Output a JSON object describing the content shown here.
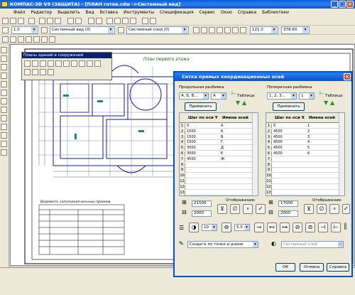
{
  "window": {
    "title": "КОМПАС-3D V9 (ЗАЩИТА) - [ПЛАН готов.cdw ->Системный вид]"
  },
  "menu": [
    "Файл",
    "Редактор",
    "Выделить",
    "Вид",
    "Вставка",
    "Инструменты",
    "Спецификация",
    "Сервис",
    "Окно",
    "Справка",
    "Библиотеки"
  ],
  "toolbar": {
    "scale": "1.0",
    "view": "Системный вид (0)",
    "layer": "Системный слой (0)",
    "x_value": "121.0",
    "y_value": "378.60"
  },
  "panel": {
    "title": "Планы зданий и сооружений"
  },
  "drawing": {
    "plan_label": "План первого этажа",
    "table_title": "Ведомость заполнения оконных проемов"
  },
  "dialog": {
    "title": "Сетка прямых координационных осей",
    "left": {
      "section": "Продольная разбивка",
      "name_combo": "А, Б, В...",
      "start_combo": "А",
      "apply": "Применить",
      "table_label": "Таблица",
      "col_step": "Шаг по оси Y",
      "col_name": "Имена осей",
      "rows": [
        [
          "1",
          "0",
          "А"
        ],
        [
          "2",
          "1500",
          "Б"
        ],
        [
          "3",
          "1500",
          "В"
        ],
        [
          "4",
          "1500",
          "Г"
        ],
        [
          "5",
          "3000",
          "Д"
        ],
        [
          "6",
          "3000",
          "Е"
        ],
        [
          "7",
          "4500",
          "Ж"
        ],
        [
          "8",
          "",
          ""
        ],
        [
          "9",
          "",
          ""
        ],
        [
          "10",
          "",
          ""
        ],
        [
          "11",
          "",
          ""
        ],
        [
          "12",
          "",
          ""
        ],
        [
          "13",
          "",
          ""
        ]
      ],
      "size1": "21500",
      "size2": "2000",
      "display_label": "Отображение:"
    },
    "right": {
      "section": "Поперечная разбивка",
      "name_combo": "1, 2, 3...",
      "start_combo": "1",
      "apply": "Применить",
      "table_label": "Таблица",
      "col_step": "Шаг по оси X",
      "col_name": "Имена осей",
      "rows": [
        [
          "1",
          "0",
          "1"
        ],
        [
          "2",
          "4500",
          "2"
        ],
        [
          "3",
          "4500",
          "3"
        ],
        [
          "4",
          "4500",
          "4"
        ],
        [
          "5",
          "4500",
          "5"
        ],
        [
          "6",
          "4500",
          "6"
        ],
        [
          "7",
          "",
          ""
        ],
        [
          "8",
          "",
          ""
        ],
        [
          "9",
          "",
          ""
        ],
        [
          "10",
          "",
          ""
        ],
        [
          "11",
          "",
          ""
        ],
        [
          "12",
          "",
          ""
        ],
        [
          "13",
          "",
          ""
        ]
      ],
      "size1": "17000",
      "size2": "2000",
      "display_label": "Отображение:"
    },
    "bottom": {
      "value1": "10",
      "value2": "5.0",
      "mode_combo": "Создать по точке и длине",
      "layer_combo": "Системный слой"
    },
    "buttons": {
      "ok": "ОК",
      "cancel": "Отмена",
      "help": "Справка"
    }
  }
}
